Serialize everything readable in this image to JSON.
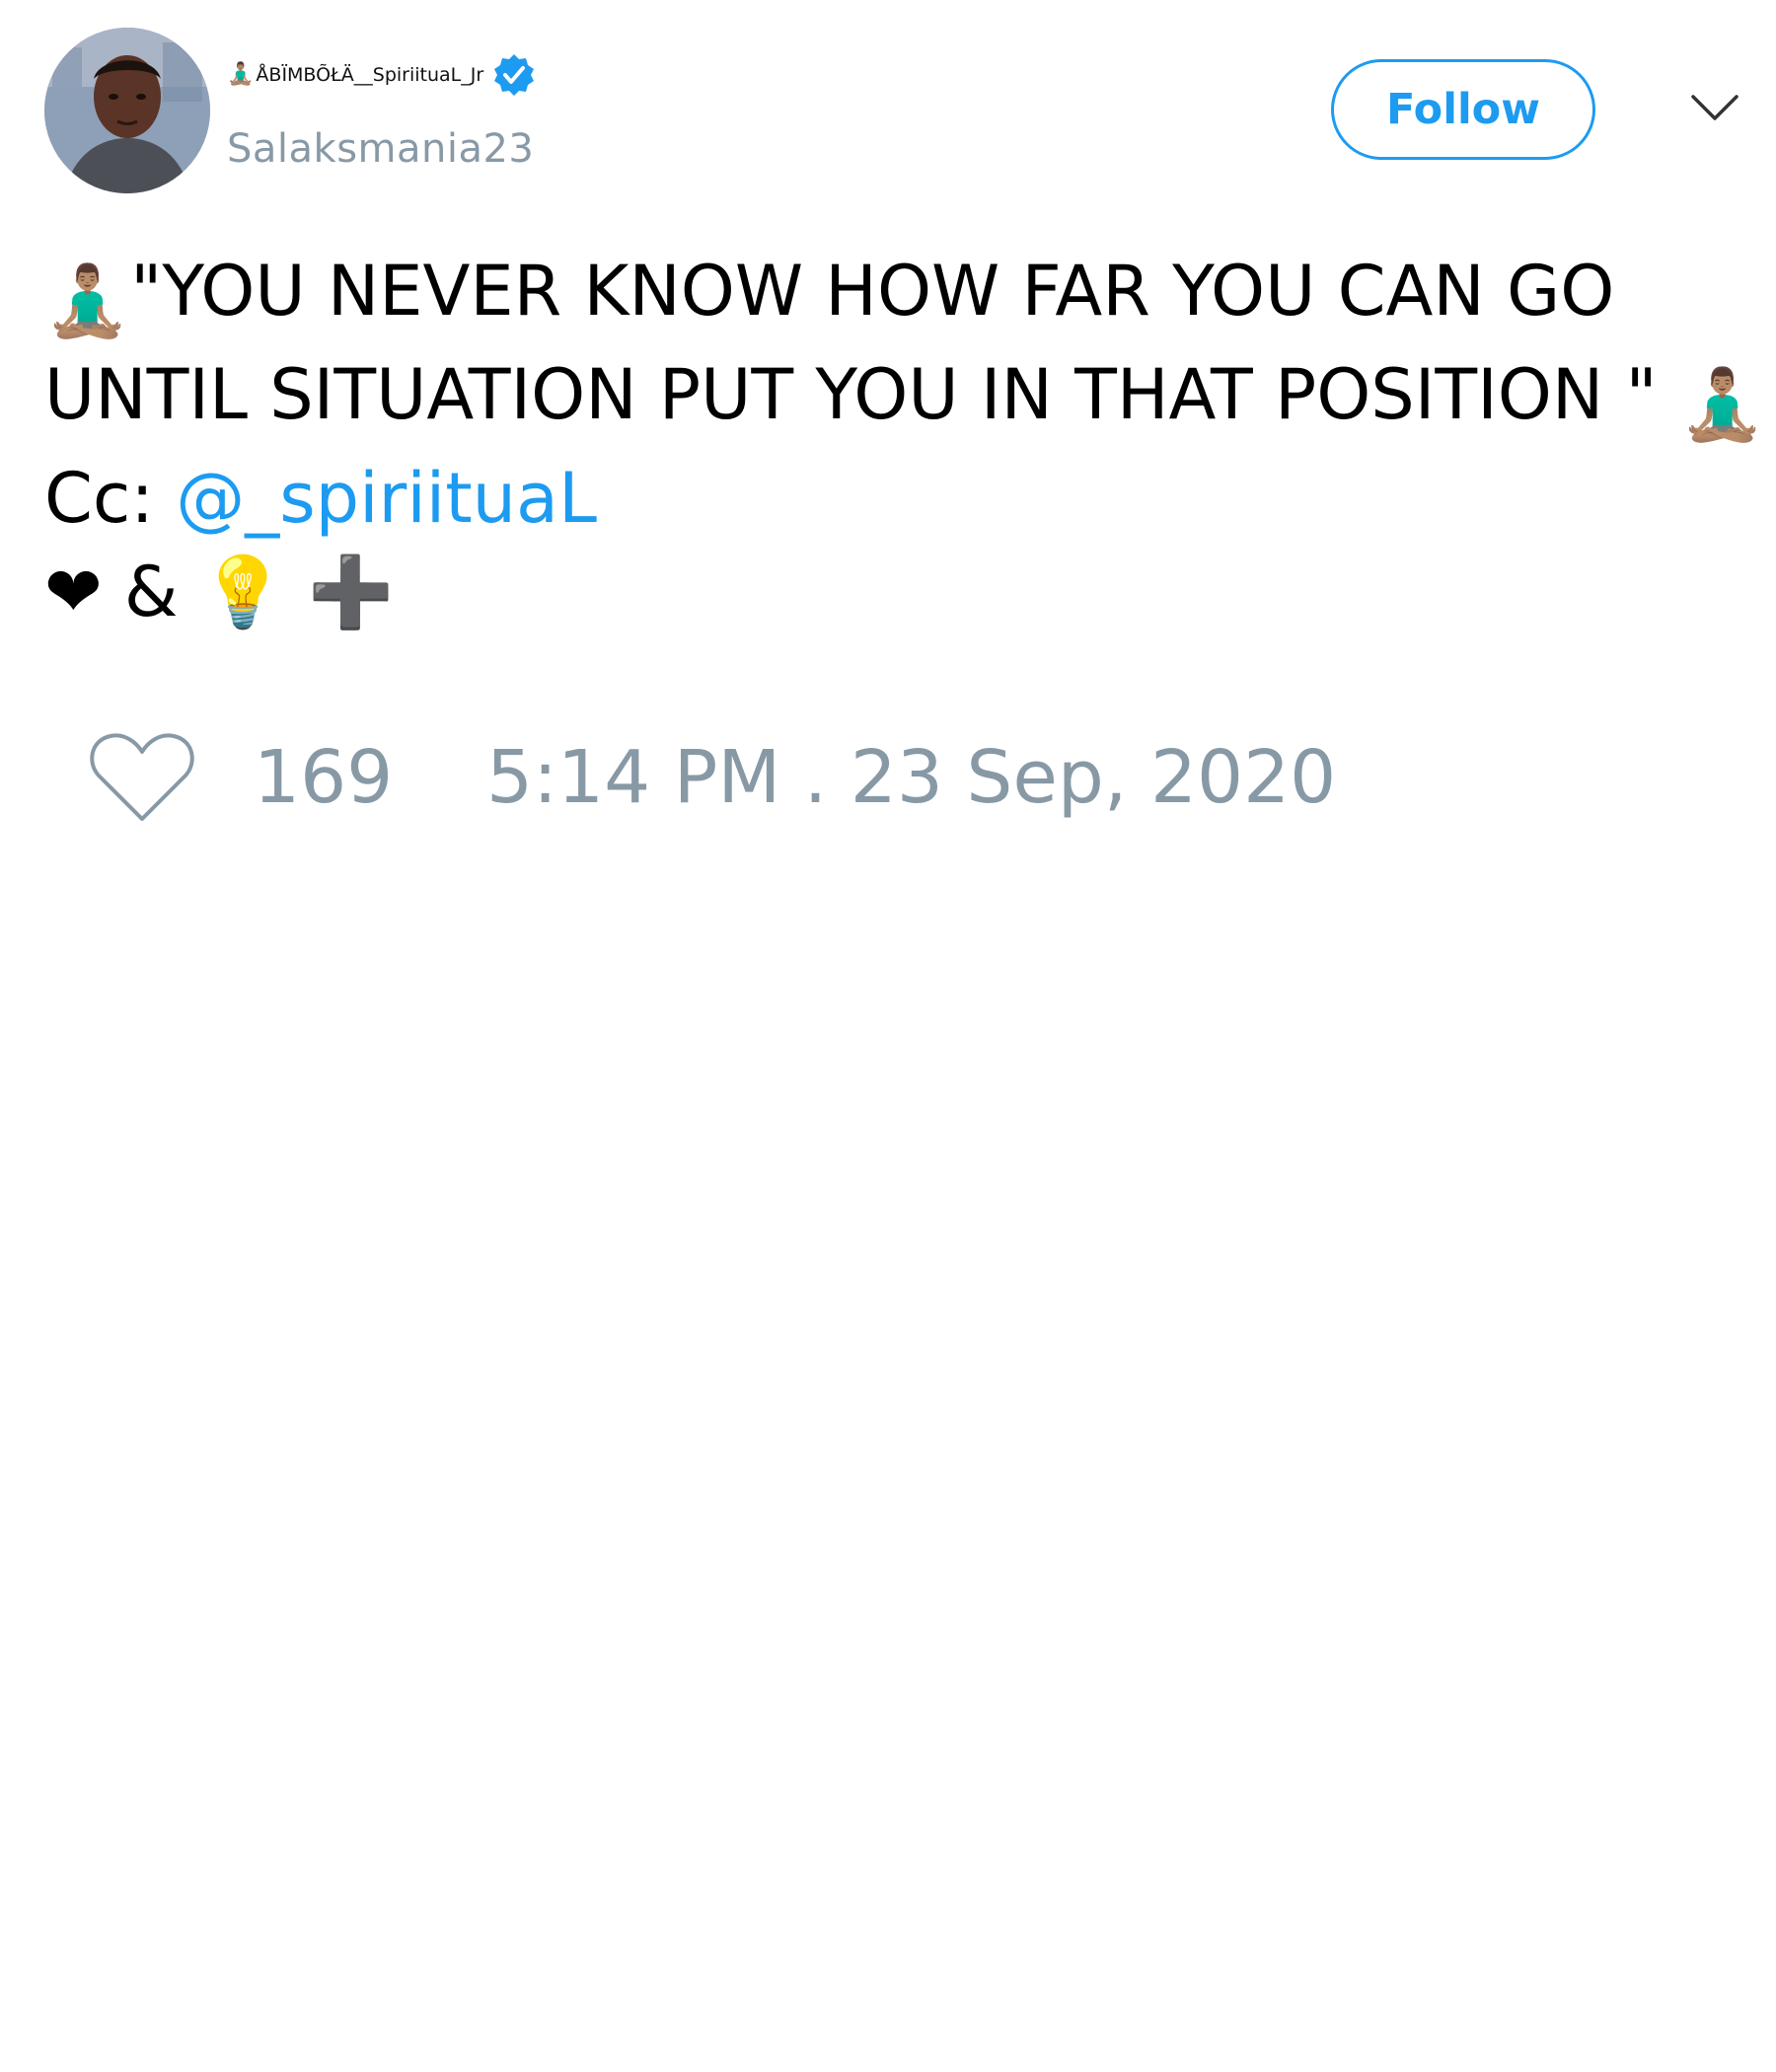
{
  "author": {
    "display_name": "ÅBÏMBÕŁÄ__SpiriituaL_Jr",
    "name_emoji": "🧘🏽‍♂️",
    "handle": "Salaksmania23",
    "verified": true,
    "avatar_icon": "avatar-photo"
  },
  "follow_button": {
    "label": "Follow"
  },
  "menu": {
    "icon": "chevron-down-icon"
  },
  "tweet": {
    "line1_emoji": "🧘🏽‍♂️",
    "line1_text": "\"YOU NEVER KNOW HOW FAR YOU CAN GO",
    "line2_text": "UNTIL SITUATION PUT YOU IN THAT POSITION \"",
    "line2_emoji": "🧘🏽‍♂️",
    "line3_prefix": "Cc: ",
    "mention": "@_spiriituaL",
    "line4_heart": "❤",
    "line4_amp": "&",
    "line4_bulb": "💡",
    "line4_plus": "➕"
  },
  "stats": {
    "like_count": "169",
    "timestamp": "5:14 PM . 23 Sep, 2020",
    "like_icon": "heart-outline-icon"
  },
  "colors": {
    "accent": "#1d9bf0",
    "secondary_text": "#8899a6",
    "primary_text": "#000000"
  }
}
